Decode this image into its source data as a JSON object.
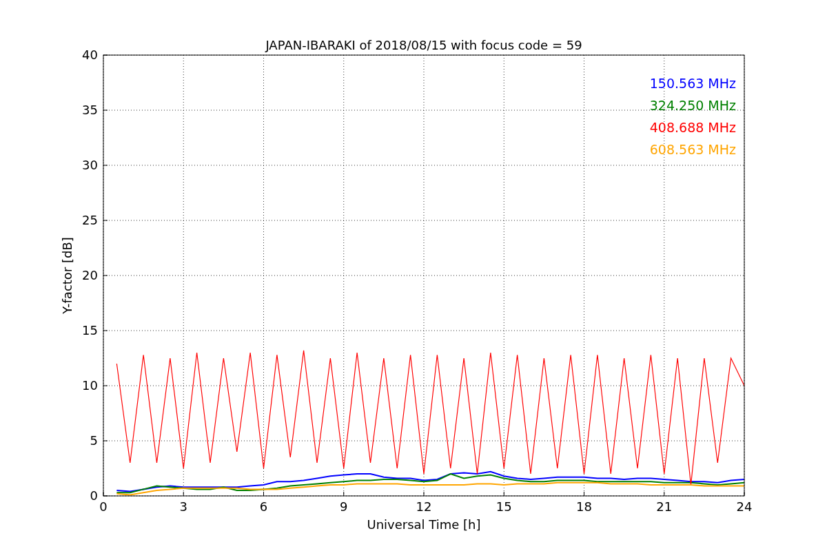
{
  "chart_data": {
    "type": "line",
    "title": "JAPAN-IBARAKI of 2018/08/15 with focus code = 59",
    "xlabel": "Universal Time [h]",
    "ylabel": "Y-factor [dB]",
    "x": [
      0.5,
      1,
      1.5,
      2,
      2.5,
      3,
      3.5,
      4,
      4.5,
      5,
      5.5,
      6,
      6.5,
      7,
      7.5,
      8,
      8.5,
      9,
      9.5,
      10,
      10.5,
      11,
      11.5,
      12,
      12.5,
      13,
      13.5,
      14,
      14.5,
      15,
      15.5,
      16,
      16.5,
      17,
      17.5,
      18,
      18.5,
      19,
      19.5,
      20,
      20.5,
      21,
      21.5,
      22,
      22.5,
      23,
      23.5,
      24
    ],
    "series": [
      {
        "name": "150.563 MHz",
        "color": "#0000ff",
        "values": [
          0.5,
          0.4,
          0.6,
          0.8,
          0.9,
          0.8,
          0.8,
          0.8,
          0.8,
          0.8,
          0.9,
          1.0,
          1.3,
          1.3,
          1.4,
          1.6,
          1.8,
          1.9,
          2.0,
          2.0,
          1.7,
          1.6,
          1.6,
          1.4,
          1.5,
          2.0,
          2.1,
          2.0,
          2.2,
          1.8,
          1.6,
          1.5,
          1.6,
          1.7,
          1.7,
          1.7,
          1.6,
          1.6,
          1.5,
          1.6,
          1.6,
          1.5,
          1.4,
          1.3,
          1.3,
          1.2,
          1.4,
          1.5
        ]
      },
      {
        "name": "324.250 MHz",
        "color": "#008000",
        "values": [
          0.3,
          0.3,
          0.6,
          0.9,
          0.8,
          0.7,
          0.6,
          0.6,
          0.8,
          0.5,
          0.5,
          0.6,
          0.7,
          0.9,
          1.0,
          1.1,
          1.2,
          1.3,
          1.4,
          1.4,
          1.5,
          1.5,
          1.4,
          1.3,
          1.4,
          2.0,
          1.6,
          1.8,
          1.9,
          1.6,
          1.4,
          1.3,
          1.3,
          1.4,
          1.4,
          1.4,
          1.3,
          1.3,
          1.3,
          1.3,
          1.3,
          1.2,
          1.2,
          1.2,
          1.1,
          1.0,
          1.1,
          1.2
        ]
      },
      {
        "name": "408.688 MHz",
        "color": "#ff0000",
        "values": [
          12,
          3,
          12.8,
          3,
          12.5,
          2.5,
          13,
          3,
          12.5,
          4,
          13,
          2.5,
          12.8,
          3.5,
          13.2,
          3,
          12.5,
          2.5,
          13,
          3,
          12.5,
          2.5,
          12.8,
          2,
          12.8,
          2.5,
          12.5,
          2,
          13,
          2.5,
          12.8,
          2,
          12.5,
          2.5,
          12.8,
          2,
          12.8,
          2,
          12.5,
          2.5,
          12.8,
          2,
          12.5,
          1,
          12.5,
          3,
          12.5,
          10
        ]
      },
      {
        "name": "608.563 MHz",
        "color": "#ffa500",
        "values": [
          0.2,
          0.1,
          0.3,
          0.5,
          0.6,
          0.7,
          0.7,
          0.7,
          0.7,
          0.7,
          0.6,
          0.6,
          0.6,
          0.7,
          0.8,
          0.9,
          1.0,
          1.0,
          1.1,
          1.1,
          1.1,
          1.1,
          1.0,
          1.0,
          1.0,
          1.0,
          1.0,
          1.1,
          1.1,
          1.0,
          1.1,
          1.1,
          1.1,
          1.2,
          1.2,
          1.2,
          1.2,
          1.1,
          1.1,
          1.1,
          1.0,
          1.0,
          1.0,
          1.0,
          0.9,
          0.9,
          0.9,
          0.9
        ]
      }
    ],
    "grid": true,
    "xlim": [
      0,
      24
    ],
    "ylim": [
      0,
      40
    ],
    "xticks": [
      0,
      3,
      6,
      9,
      12,
      15,
      18,
      21,
      24
    ],
    "yticks": [
      0,
      5,
      10,
      15,
      20,
      25,
      30,
      35,
      40
    ]
  }
}
